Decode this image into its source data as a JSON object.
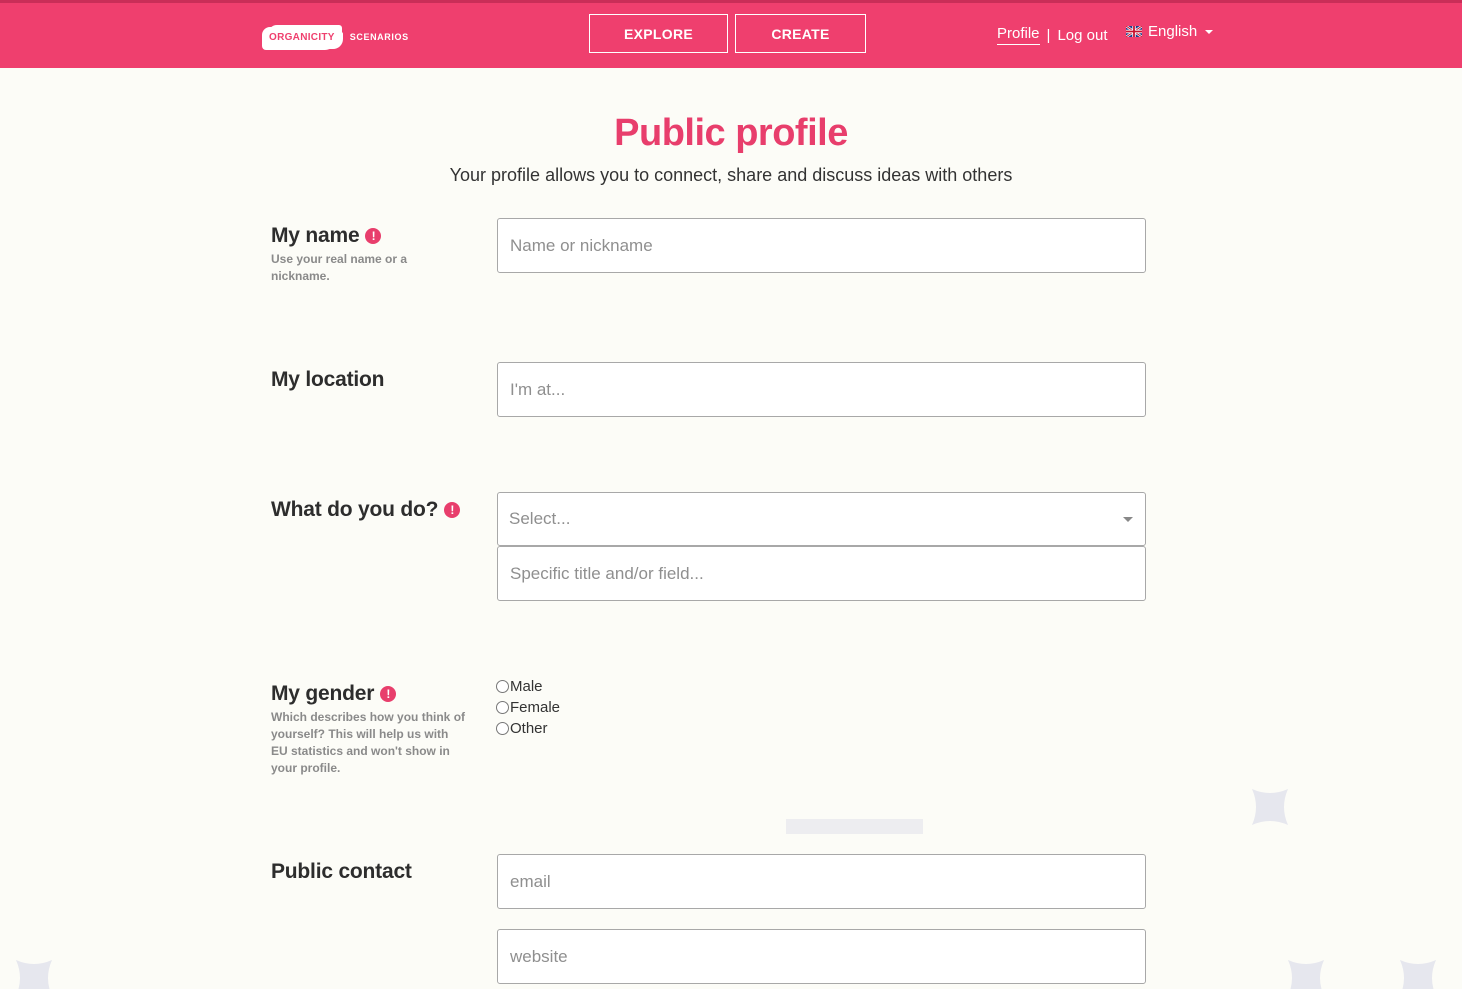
{
  "header": {
    "logo_badge": "ORGANICITY",
    "logo_sub": "SCENARIOS",
    "explore_label": "EXPLORE",
    "create_label": "CREATE",
    "profile_label": "Profile",
    "separator": "|",
    "logout_label": "Log out",
    "language_label": "English",
    "language_flag_icon": "uk-flag-icon",
    "brand_color": "#ef3f6e"
  },
  "page": {
    "title": "Public profile",
    "subtitle": "Your profile allows you to connect, share and discuss ideas with others",
    "title_color": "#e83e6c"
  },
  "form": {
    "name": {
      "label": "My name",
      "required_icon": "!",
      "help": "Use your real name or a nickname.",
      "placeholder": "Name or nickname"
    },
    "location": {
      "label": "My location",
      "placeholder": "I'm at..."
    },
    "occupation": {
      "label": "What do you do?",
      "required_icon": "!",
      "select_value": "Select...",
      "specific_placeholder": "Specific title and/or field..."
    },
    "gender": {
      "label": "My gender",
      "required_icon": "!",
      "help": "Which describes how you think of yourself? This will help us with EU statistics and won't show in your profile.",
      "options": [
        "Male",
        "Female",
        "Other"
      ]
    },
    "contact": {
      "label": "Public contact",
      "email_placeholder": "email",
      "website_placeholder": "website"
    }
  }
}
